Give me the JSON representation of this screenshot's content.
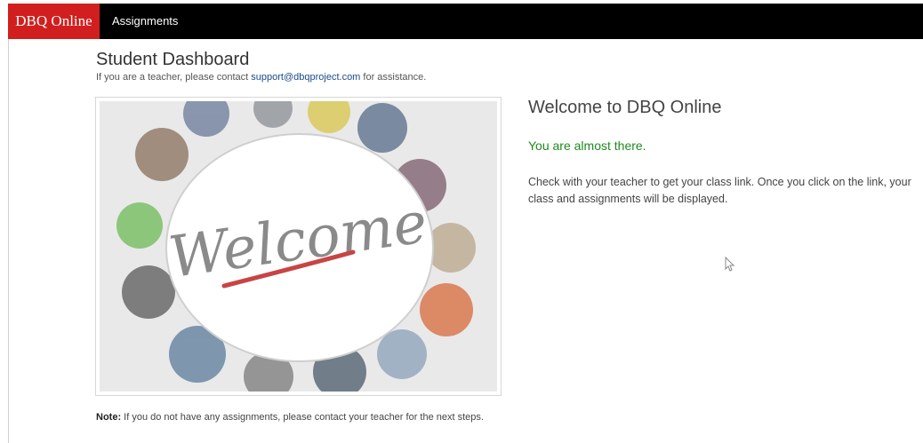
{
  "navbar": {
    "brand": "DBQ Online",
    "links": [
      {
        "label": "Assignments"
      }
    ]
  },
  "header": {
    "title": "Student Dashboard",
    "subtitle_prefix": "If you are a teacher, please contact ",
    "support_email": "support@dbqproject.com",
    "subtitle_suffix": " for assistance."
  },
  "image": {
    "caption_text": "Welcome"
  },
  "welcome": {
    "heading": "Welcome to DBQ Online",
    "status": "You are almost there.",
    "body": "Check with your teacher to get your class link. Once you click on the link, your class and assignments will be displayed."
  },
  "footer_note": {
    "label": "Note:",
    "text": " If you do not have any assignments, please contact your teacher for the next steps."
  },
  "colors": {
    "brand": "#d11f1f",
    "navbar": "#000000",
    "status": "#1e8a1e",
    "link": "#1a4a8a"
  }
}
